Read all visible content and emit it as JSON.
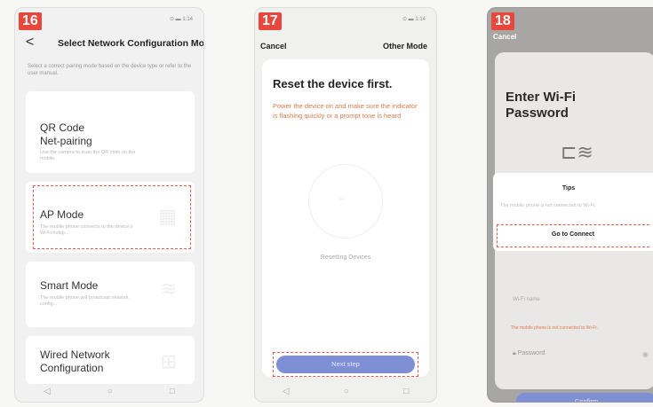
{
  "step1": {
    "badge": "16",
    "status": "⊙ ▬ 1:14",
    "back": "<",
    "title": "Select Network Configuration Mo...",
    "description": "Select a correct pairing mode based on the device type or refer to the user manual.",
    "modes": [
      {
        "name": "QR Code\nNet-pairing",
        "desc": "Use the camera to scan the QR code on the mobile."
      },
      {
        "name": "AP Mode",
        "desc": "The mobile phone connects to the device's Wi-Fi hotsp..."
      },
      {
        "name": "Smart Mode",
        "desc": "The mobile phone will broadcast network config..."
      },
      {
        "name": "Wired Network\nConfiguration",
        "desc": ""
      }
    ]
  },
  "step2": {
    "badge": "17",
    "status": "⊙ ▬ 1:14",
    "cancel": "Cancel",
    "other_mode": "Other Mode",
    "heading": "Reset the device first.",
    "body": "Power the device on and make sure the indicator is flashing quickly or a prompt tone is heard",
    "resetting": "Resetting Devices",
    "next": "Next step"
  },
  "step3": {
    "badge": "18",
    "cancel": "Cancel",
    "heading": "Enter Wi-Fi Password",
    "tips": "Tips",
    "dialog_msg": "The mobile phone is not connected to Wi-Fi.",
    "go_connect": "Go to Connect",
    "ssid": "Wi-Fi name",
    "warning": "The mobile phone is not connected to Wi-Fi.",
    "password_placeholder": "Password",
    "confirm": "Confirm"
  },
  "navbar": [
    "◁",
    "○",
    "□"
  ]
}
